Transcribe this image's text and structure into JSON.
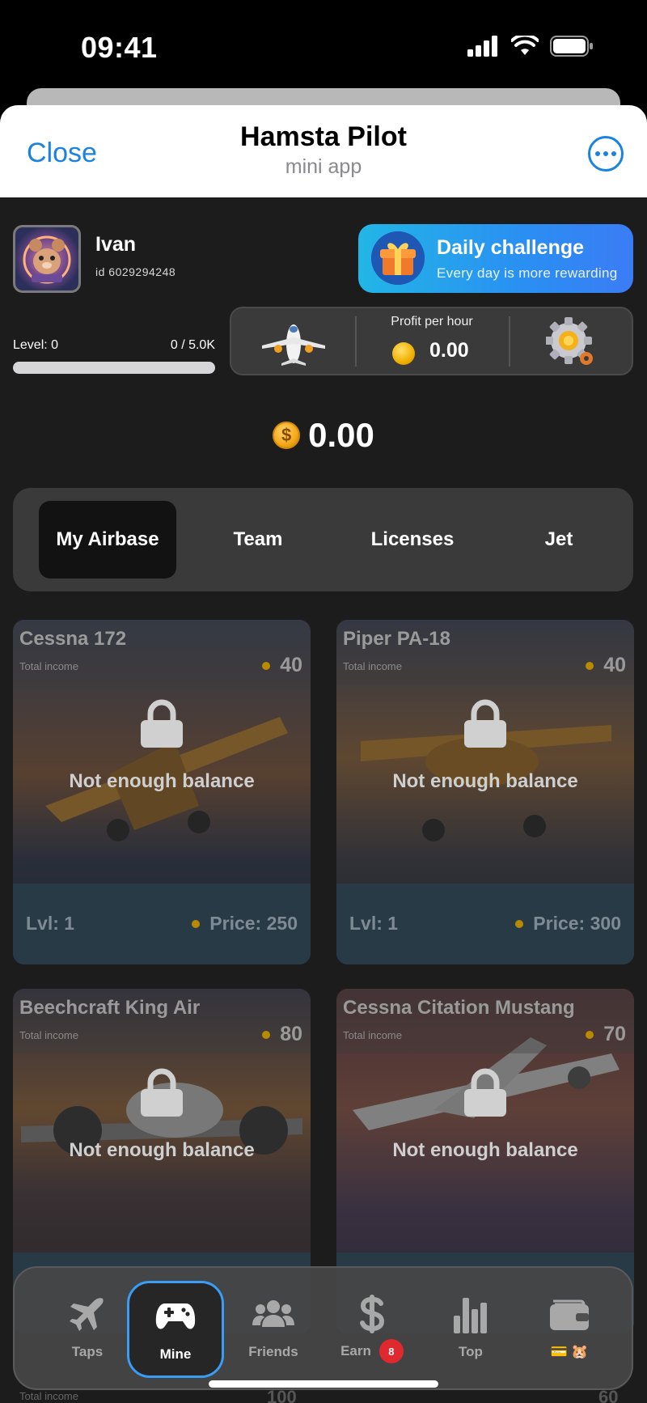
{
  "status_bar": {
    "time": "09:41"
  },
  "header": {
    "close_label": "Close",
    "title": "Hamsta Pilot",
    "subtitle": "mini app"
  },
  "user": {
    "name": "Ivan",
    "id_text": "id 6029294248"
  },
  "daily_challenge": {
    "title": "Daily challenge",
    "subtitle": "Every day is more rewarding"
  },
  "level": {
    "label": "Level: 0",
    "progress_text": "0 / 5.0K",
    "progress_fraction": 0
  },
  "stats": {
    "profit_label": "Profit per hour",
    "profit_value": "0.00"
  },
  "balance": {
    "value": "0.00"
  },
  "tabs": [
    {
      "label": "My Airbase",
      "active": true
    },
    {
      "label": "Team",
      "active": false
    },
    {
      "label": "Licenses",
      "active": false
    },
    {
      "label": "Jet",
      "active": false
    }
  ],
  "cards": [
    {
      "name": "Cessna 172",
      "income_label": "Total income",
      "income": "40",
      "locked_text": "Not enough balance",
      "level": "Lvl: 1",
      "price": "Price: 250"
    },
    {
      "name": "Piper PA-18",
      "income_label": "Total income",
      "income": "40",
      "locked_text": "Not enough balance",
      "level": "Lvl: 1",
      "price": "Price: 300"
    },
    {
      "name": "Beechcraft King Air",
      "income_label": "Total income",
      "income": "80",
      "locked_text": "Not enough balance"
    },
    {
      "name": "Cessna Citation Mustang",
      "income_label": "Total income",
      "income": "70",
      "locked_text": "Not enough balance"
    }
  ],
  "peek_row": {
    "income_label": "Total income",
    "left_income": "100",
    "right_income": "60"
  },
  "nav": [
    {
      "label": "Taps",
      "icon": "plane-icon",
      "active": false
    },
    {
      "label": "Mine",
      "icon": "gamepad-icon",
      "active": true
    },
    {
      "label": "Friends",
      "icon": "users-icon",
      "active": false
    },
    {
      "label": "Earn",
      "icon": "dollar-icon",
      "active": false,
      "badge": "8"
    },
    {
      "label": "Top",
      "icon": "bar-chart-icon",
      "active": false
    },
    {
      "label": "💳 🐹",
      "icon": "wallet-icon",
      "active": false
    }
  ],
  "colors": {
    "accent": "#1a82e2",
    "active_nav_border": "#3a9cf5",
    "badge": "#e0282f",
    "daily_gradient_start": "#22b6e6",
    "daily_gradient_end": "#3b7cf5"
  }
}
